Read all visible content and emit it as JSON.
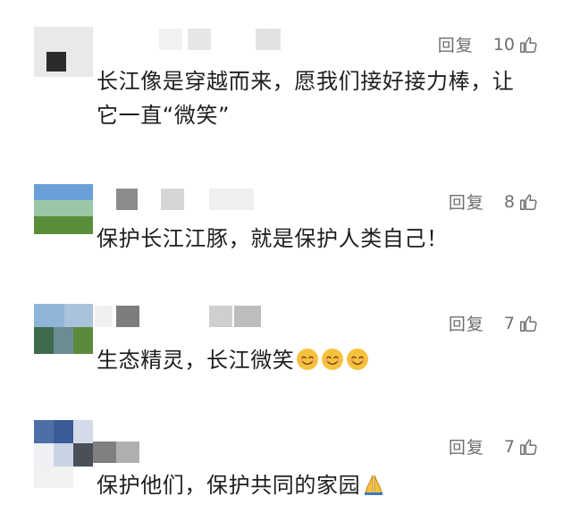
{
  "comments": [
    {
      "reply_label": "回复",
      "like_count": "10",
      "text": "长江像是穿越而来，愿我们接好接力棒，让它一直“微笑”",
      "emojis": []
    },
    {
      "reply_label": "回复",
      "like_count": "8",
      "text": "保护长江江豚，就是保护人类自己！",
      "emojis": []
    },
    {
      "reply_label": "回复",
      "like_count": "7",
      "text": "生态精灵，长江微笑",
      "emojis": [
        "smiling-face",
        "smiling-face",
        "smiling-face"
      ]
    },
    {
      "reply_label": "回复",
      "like_count": "7",
      "text": "保护他们，保护共同的家园",
      "emojis": [
        "folded-hands"
      ]
    }
  ],
  "colors": {
    "text": "#1e1e1e",
    "meta": "#6f6f6f",
    "background": "#ffffff",
    "emoji_face": "#f6c23e"
  }
}
